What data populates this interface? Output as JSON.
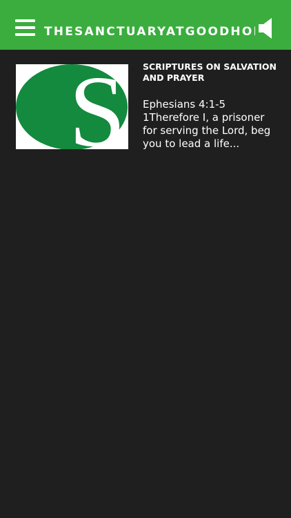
{
  "header": {
    "title": "THESANCTUARYATGOODHOPE.C",
    "menu_icon": "hamburger-menu-icon",
    "speaker_icon": "speaker-icon",
    "background_color": "#3aad3e"
  },
  "feed": {
    "items": [
      {
        "title": "SCRIPTURES ON SALVATION AND PRAYER",
        "excerpt": "Ephesians 4:1-5\n1Therefore I, a prisoner for serving the Lord, beg you to lead a life...",
        "thumbnail_letter": "S",
        "thumbnail_color": "#138a3e"
      }
    ]
  }
}
